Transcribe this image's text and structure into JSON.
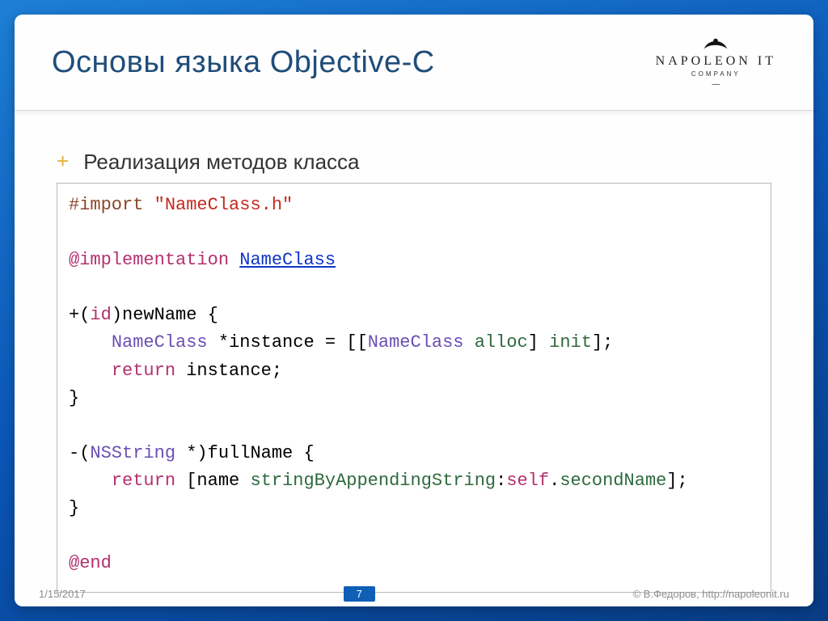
{
  "header": {
    "title": "Основы языка Objective-C",
    "logo": {
      "main": "NAPOLEON IT",
      "sub": "COMPANY"
    }
  },
  "body": {
    "subtitle": "Реализация методов класса",
    "code": {
      "l1_import": "#import",
      "l1_file": "\"NameClass.h\"",
      "l2_impl": "@implementation",
      "l2_class": "NameClass",
      "l3_plus": "+(",
      "l3_id": "id",
      "l3_newname": ")newName {",
      "l4_indent": "    ",
      "l4_type": "NameClass",
      "l4_instance": " *instance = [[",
      "l4_type2": "NameClass",
      "l4_space": " ",
      "l4_alloc": "alloc",
      "l4_brk": "] ",
      "l4_init": "init",
      "l4_end": "];",
      "l5_return": "return",
      "l5_instance": " instance;",
      "l6_brace": "}",
      "l7_minus": "-(",
      "l7_nsstring": "NSString",
      "l7_fullname": " *)fullName {",
      "l8_return": "return",
      "l8_name": " [name ",
      "l8_append": "stringByAppendingString",
      "l8_colon": ":",
      "l8_self": "self",
      "l8_dot": ".",
      "l8_second": "secondName",
      "l8_endbrk": "];",
      "l9_brace": "}",
      "l10_end": "@end"
    }
  },
  "footer": {
    "date": "1/15/2017",
    "page": "7",
    "copyright": "© В.Федоров, http://napoleonit.ru"
  }
}
